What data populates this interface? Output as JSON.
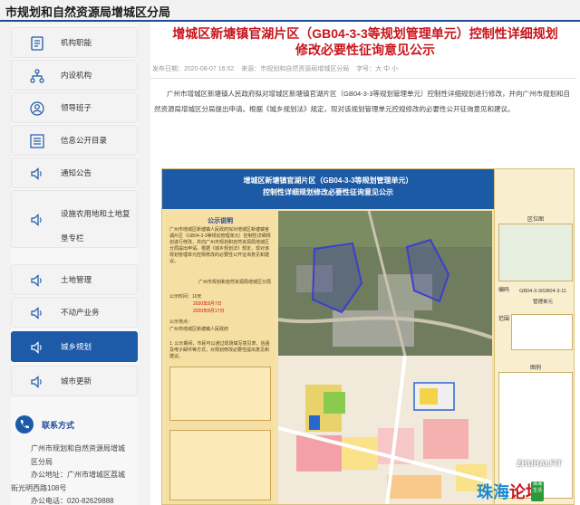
{
  "site": {
    "title": "市规划和自然资源局增城区分局"
  },
  "sidebar": {
    "items": [
      {
        "label": "机构职能",
        "icon": "document-icon"
      },
      {
        "label": "内设机构",
        "icon": "org-chart-icon"
      },
      {
        "label": "领导班子",
        "icon": "user-icon"
      },
      {
        "label": "信息公开目录",
        "icon": "list-icon"
      },
      {
        "label": "通知公告",
        "icon": "speaker-icon"
      },
      {
        "label": "设施农用地和土地复垦专栏",
        "icon": "speaker-icon"
      },
      {
        "label": "土地管理",
        "icon": "speaker-icon"
      },
      {
        "label": "不动产业务",
        "icon": "speaker-icon"
      },
      {
        "label": "城乡规划",
        "icon": "speaker-icon"
      },
      {
        "label": "城市更新",
        "icon": "speaker-icon"
      }
    ],
    "active_index": 8,
    "active_color": "#1d5aa8"
  },
  "contact": {
    "title": "联系方式",
    "line1": "广州市规划和自然资源局增城",
    "line2": "区分局",
    "line3": "办公地址：广州市增城区荔城",
    "line4": "街光明西路108号",
    "line5": "办公电话：020-82629888"
  },
  "article": {
    "title_line1": "增城区新塘镇官湖片区（GB04-3-3等规划管理单元）控制性详细规划",
    "title_line2": "修改必要性征询意见公示",
    "published": "发布日期：2020-08-07 16:52",
    "source": "来源：市规划和自然资源局增城区分局",
    "font_size": "字号：大 中 小",
    "body": "广州市增城区新塘镇人民政府拟对增城区新塘镇官湖片区（GB04-3-3等规划管理单元）控制性详细规划进行修改，并向广州市规划和自然资源局增城区分局提出申请。根据《城乡规划法》规定，现对该规划管理单元控规修改的必要性公开征询意见和建议。",
    "title_color": "#c8151c"
  },
  "notice": {
    "head_line1": "增城区新塘镇官湖片区（GB04-3-3等规划管理单元）",
    "head_line2": "控制性详细规划修改必要性征询意见公示",
    "left_title": "公示说明",
    "right_location": "区位图",
    "right_code_label": "编码",
    "right_code": "GB04-3-3/GB04-3-11",
    "right_code_sub": "管理单元",
    "right_scope": "范围",
    "right_legend": "图例",
    "left_para1": "广州市增城区新塘镇人民政府拟对增城区新塘镇官湖片区（GB04-3-3等规划管理单元）控制性详细规划进行修改，并向广州市规划和自然资源局增城区分局提出申请。根据《城乡规划法》规定，现对该规划管理单元控规修改的必要性公开征询意见和建议。",
    "left_org": "广州市规划和自然资源局增城区分局",
    "left_period_label": "公示时间：10天",
    "left_date1": "2020年8月7日",
    "left_date2": "2020年8月17日",
    "left_place": "公示地点：",
    "left_place_val": "广州市增城区新塘镇人民政府",
    "left_para2": "1. 公示期间，市民可以通过现场填写意见表、信函及电子邮件等方式，对规划修改必要性提出意见和建议。",
    "head_color": "#1c5aa5"
  },
  "watermark": {
    "site": "ZHUHAI.FIT",
    "logo_a": "珠海",
    "logo_b": "论坛",
    "logo_tag": "珠海生活"
  }
}
